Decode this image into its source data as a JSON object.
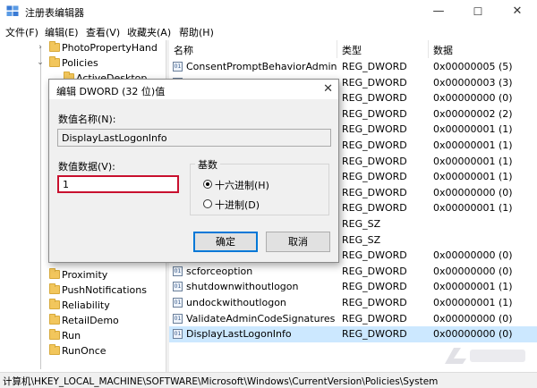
{
  "window": {
    "title": "注册表编辑器",
    "minimize": "—",
    "maximize": "☐",
    "close": "✕"
  },
  "menu": [
    "文件(F)",
    "编辑(E)",
    "查看(V)",
    "收藏夹(A)",
    "帮助(H)"
  ],
  "tree": {
    "top_items": [
      {
        "label": "PhotoPropertyHand",
        "chevron": "›"
      },
      {
        "label": "Policies",
        "chevron": "⌄"
      },
      {
        "label": "ActiveDesktop",
        "chevron": ""
      }
    ],
    "bottom_items": [
      {
        "label": "Proximity",
        "chevron": ""
      },
      {
        "label": "PushNotifications",
        "chevron": ""
      },
      {
        "label": "Reliability",
        "chevron": ""
      },
      {
        "label": "RetailDemo",
        "chevron": ""
      },
      {
        "label": "Run",
        "chevron": ""
      },
      {
        "label": "RunOnce",
        "chevron": ""
      }
    ]
  },
  "list": {
    "headers": {
      "name": "名称",
      "type": "类型",
      "data": "数据"
    },
    "rows": [
      {
        "name": "ConsentPromptBehaviorAdmin",
        "type": "REG_DWORD",
        "data": "0x00000005 (5)",
        "icon": "dword-icon",
        "selected": false
      },
      {
        "name": "",
        "type": "REG_DWORD",
        "data": "0x00000003 (3)",
        "icon": "dword-icon",
        "selected": false
      },
      {
        "name": "",
        "type": "REG_DWORD",
        "data": "0x00000000 (0)",
        "icon": "dword-icon",
        "selected": false
      },
      {
        "name": "",
        "type": "REG_DWORD",
        "data": "0x00000002 (2)",
        "icon": "dword-icon",
        "selected": false
      },
      {
        "name": "",
        "type": "REG_DWORD",
        "data": "0x00000001 (1)",
        "icon": "dword-icon",
        "selected": false
      },
      {
        "name": "",
        "type": "REG_DWORD",
        "data": "0x00000001 (1)",
        "icon": "dword-icon",
        "selected": false
      },
      {
        "name": "",
        "type": "REG_DWORD",
        "data": "0x00000001 (1)",
        "icon": "dword-icon",
        "selected": false
      },
      {
        "name": "",
        "type": "REG_DWORD",
        "data": "0x00000001 (1)",
        "icon": "dword-icon",
        "selected": false
      },
      {
        "name": "",
        "type": "REG_DWORD",
        "data": "0x00000000 (0)",
        "icon": "dword-icon",
        "selected": false
      },
      {
        "name": "",
        "type": "REG_DWORD",
        "data": "0x00000001 (1)",
        "icon": "dword-icon",
        "selected": false
      },
      {
        "name": "",
        "type": "REG_SZ",
        "data": "",
        "icon": "string-icon",
        "selected": false
      },
      {
        "name": "",
        "type": "REG_SZ",
        "data": "",
        "icon": "string-icon",
        "selected": false
      },
      {
        "name": "",
        "type": "REG_DWORD",
        "data": "0x00000000 (0)",
        "icon": "dword-icon",
        "selected": false
      },
      {
        "name": "scforceoption",
        "type": "REG_DWORD",
        "data": "0x00000000 (0)",
        "icon": "dword-icon",
        "selected": false
      },
      {
        "name": "shutdownwithoutlogon",
        "type": "REG_DWORD",
        "data": "0x00000001 (1)",
        "icon": "dword-icon",
        "selected": false
      },
      {
        "name": "undockwithoutlogon",
        "type": "REG_DWORD",
        "data": "0x00000001 (1)",
        "icon": "dword-icon",
        "selected": false
      },
      {
        "name": "ValidateAdminCodeSignatures",
        "type": "REG_DWORD",
        "data": "0x00000000 (0)",
        "icon": "dword-icon",
        "selected": false
      },
      {
        "name": "DisplayLastLogonInfo",
        "type": "REG_DWORD",
        "data": "0x00000000 (0)",
        "icon": "dword-icon",
        "selected": true
      }
    ]
  },
  "status": {
    "path": "计算机\\HKEY_LOCAL_MACHINE\\SOFTWARE\\Microsoft\\Windows\\CurrentVersion\\Policies\\System"
  },
  "dialog": {
    "title": "编辑 DWORD (32 位)值",
    "close": "✕",
    "name_label": "数值名称(N):",
    "name_value": "DisplayLastLogonInfo",
    "data_label": "数值数据(V):",
    "data_value": "1",
    "base_label": "基数",
    "radio_hex": "十六进制(H)",
    "radio_dec": "十进制(D)",
    "ok": "确定",
    "cancel": "取消",
    "base_selected": "hex"
  },
  "colors": {
    "selection": "#cce8ff",
    "value_border": "#c8102e",
    "folder": "#f2c65c",
    "ok_border": "#0078d7"
  }
}
